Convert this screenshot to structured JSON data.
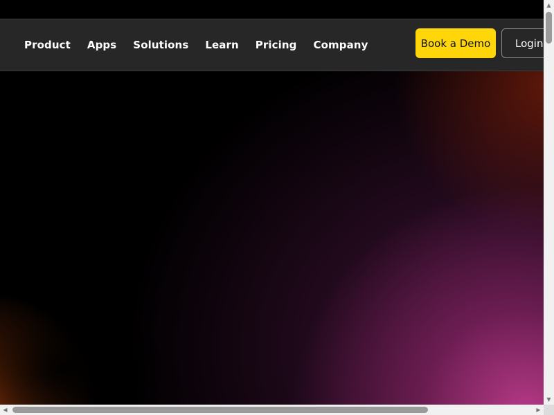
{
  "nav": {
    "links": [
      {
        "label": "Product"
      },
      {
        "label": "Apps"
      },
      {
        "label": "Solutions"
      },
      {
        "label": "Learn"
      },
      {
        "label": "Pricing"
      },
      {
        "label": "Company"
      }
    ],
    "demo_label": "Book a Demo",
    "login_label": "Login"
  },
  "colors": {
    "navbar_bg": "#272727",
    "accent": "#ffd60a",
    "hero_glow": "#be3c8c"
  },
  "icons": {
    "scroll_up": "triangle-up-icon",
    "scroll_down": "triangle-down-icon",
    "scroll_left": "triangle-left-icon",
    "scroll_right": "triangle-right-icon"
  }
}
